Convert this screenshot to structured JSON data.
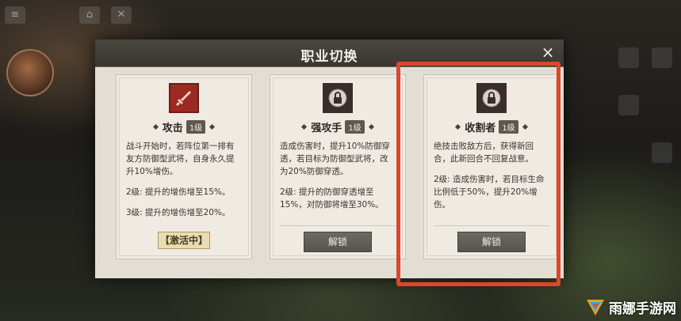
{
  "dialog": {
    "title": "职业切换",
    "close_icon": "×"
  },
  "cards": [
    {
      "name": "攻击",
      "level": "1级",
      "icon": "sword-icon",
      "status": "active",
      "desc": [
        "战斗开始时，若阵位第一排有友方防御型武将，自身永久提升10%增伤。",
        "2级: 提升的增伤增至15%。",
        "3级: 提升的增伤增至20%。"
      ],
      "active_label": "【激活中】"
    },
    {
      "name": "强攻手",
      "level": "1级",
      "icon": "lock-icon",
      "status": "locked",
      "desc": [
        "造成伤害时，提升10%防御穿透，若目标为防御型武将，改为20%防御穿透。",
        "2级: 提升的防御穿透增至15%，对防御将增至30%。"
      ],
      "unlock_label": "解锁"
    },
    {
      "name": "收割者",
      "level": "1级",
      "icon": "lock-icon",
      "status": "locked",
      "desc": [
        "绝技击败敌方后，获得新回合，此新回合不回复战意。",
        "2级: 造成伤害时，若目标生命比例低于50%，提升20%增伤。"
      ],
      "unlock_label": "解锁"
    }
  ],
  "watermark": {
    "text": "雨娜手游网",
    "logo_icon": "triangle-logo-icon"
  },
  "colors": {
    "highlight": "#e0452d",
    "active_icon_bg": "#9c2a23",
    "header_bg": "#3a3732"
  }
}
